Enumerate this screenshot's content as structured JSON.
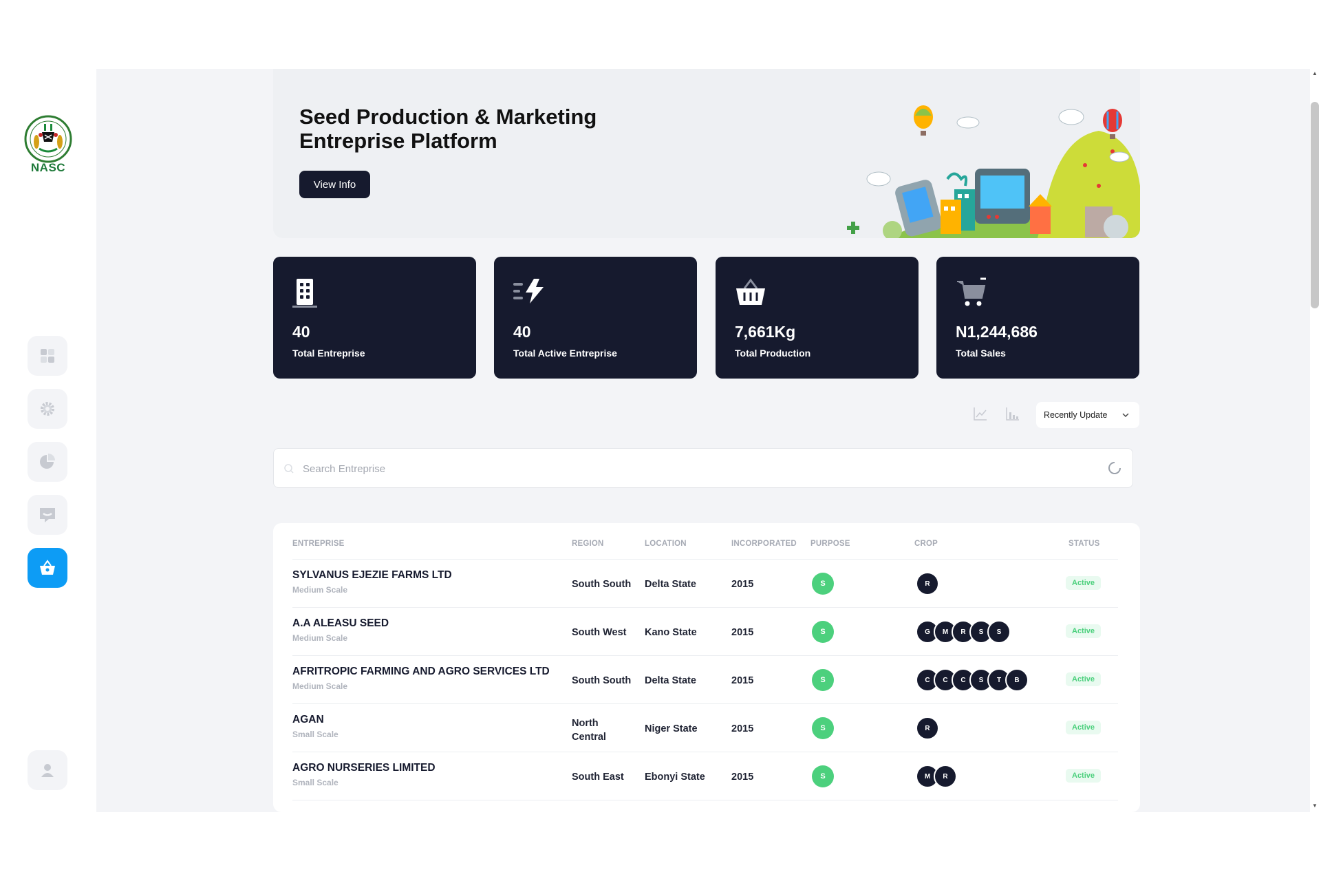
{
  "brand": {
    "logo_text": "NASC"
  },
  "nav": [
    {
      "name": "dashboard",
      "icon": "grid-icon"
    },
    {
      "name": "settings",
      "icon": "gear-icon"
    },
    {
      "name": "reports",
      "icon": "pie-chart-icon"
    },
    {
      "name": "messages",
      "icon": "message-icon"
    },
    {
      "name": "enterprise",
      "icon": "basket-icon",
      "active": true
    },
    {
      "name": "profile",
      "icon": "user-icon"
    }
  ],
  "hero": {
    "title": "Seed Production & Marketing Entreprise Platform",
    "button_label": "View Info"
  },
  "stats": [
    {
      "value": "40",
      "label": "Total Entreprise",
      "icon": "building-icon"
    },
    {
      "value": "40",
      "label": "Total Active Entreprise",
      "icon": "bolt-icon"
    },
    {
      "value": "7,661Kg",
      "label": "Total Production",
      "icon": "basket-icon"
    },
    {
      "value": "N1,244,686",
      "label": "Total Sales",
      "icon": "cart-icon"
    }
  ],
  "toolbar": {
    "sort_label": "Recently Update"
  },
  "search": {
    "placeholder": "Search Entreprise",
    "value": ""
  },
  "table": {
    "headers": [
      "ENTREPRISE",
      "REGION",
      "LOCATION",
      "INCORPORATED",
      "PURPOSE",
      "CROP",
      "STATUS"
    ],
    "rows": [
      {
        "name": "SYLVANUS EJEZIE FARMS LTD",
        "scale": "Medium Scale",
        "region": "South South",
        "location": "Delta State",
        "incorporated": "2015",
        "purpose": "S",
        "crops": [
          "R"
        ],
        "status": "Active"
      },
      {
        "name": "A.A ALEASU SEED",
        "scale": "Medium Scale",
        "region": "South West",
        "location": "Kano State",
        "incorporated": "2015",
        "purpose": "S",
        "crops": [
          "G",
          "M",
          "R",
          "S",
          "S"
        ],
        "status": "Active"
      },
      {
        "name": "AFRITROPIC FARMING AND AGRO SERVICES LTD",
        "scale": "Medium Scale",
        "region": "South South",
        "location": "Delta State",
        "incorporated": "2015",
        "purpose": "S",
        "crops": [
          "C",
          "C",
          "C",
          "S",
          "T",
          "B"
        ],
        "status": "Active"
      },
      {
        "name": "AGAN",
        "scale": "Small Scale",
        "region": "North Central",
        "location": "Niger State",
        "incorporated": "2015",
        "purpose": "S",
        "crops": [
          "R"
        ],
        "status": "Active"
      },
      {
        "name": "AGRO NURSERIES LIMITED",
        "scale": "Small Scale",
        "region": "South East",
        "location": "Ebonyi State",
        "incorporated": "2015",
        "purpose": "S",
        "crops": [
          "M",
          "R"
        ],
        "status": "Active"
      }
    ]
  },
  "colors": {
    "accent": "#0d9cf5",
    "dark": "#161a2e",
    "success": "#4cd07d",
    "background": "#f3f4f7"
  }
}
